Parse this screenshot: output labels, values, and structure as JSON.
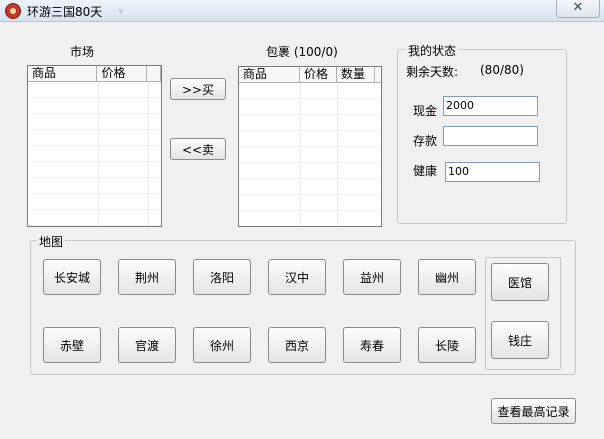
{
  "window": {
    "title": "环游三国80天",
    "close_glyph": "✕"
  },
  "market": {
    "label": "市场",
    "columns": [
      "商品",
      "价格",
      ""
    ]
  },
  "bag": {
    "label": "包裹 (100/0)",
    "columns": [
      "商品",
      "价格",
      "数量"
    ]
  },
  "actions": {
    "buy": ">>买",
    "sell": "<<卖"
  },
  "status": {
    "title": "我的状态",
    "days_label": "剩余天数:",
    "days_value": "(80/80)",
    "cash_label": "现金",
    "cash_value": "2000",
    "savings_label": "存款",
    "savings_value": "",
    "health_label": "健康",
    "health_value": "100"
  },
  "map": {
    "title": "地图",
    "row1": [
      "长安城",
      "荆州",
      "洛阳",
      "汉中",
      "益州",
      "幽州"
    ],
    "row2": [
      "赤壁",
      "官渡",
      "徐州",
      "西京",
      "寿春",
      "长陵"
    ],
    "hospital": "医馆",
    "bank": "钱庄"
  },
  "records_button": "查看最高记录"
}
